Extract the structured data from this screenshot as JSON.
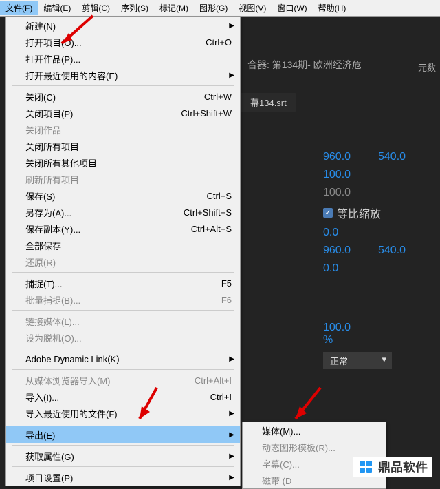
{
  "menubar": [
    "文件(F)",
    "编辑(E)",
    "剪辑(C)",
    "序列(S)",
    "标记(M)",
    "图形(G)",
    "视图(V)",
    "窗口(W)",
    "帮助(H)"
  ],
  "menu": [
    {
      "t": "item",
      "label": "新建(N)",
      "arrow": true
    },
    {
      "t": "item",
      "label": "打开项目(O)...",
      "sc": "Ctrl+O"
    },
    {
      "t": "item",
      "label": "打开作品(P)..."
    },
    {
      "t": "item",
      "label": "打开最近使用的内容(E)",
      "arrow": true
    },
    {
      "t": "sep"
    },
    {
      "t": "item",
      "label": "关闭(C)",
      "sc": "Ctrl+W"
    },
    {
      "t": "item",
      "label": "关闭项目(P)",
      "sc": "Ctrl+Shift+W"
    },
    {
      "t": "item",
      "label": "关闭作品",
      "disabled": true
    },
    {
      "t": "item",
      "label": "关闭所有项目"
    },
    {
      "t": "item",
      "label": "关闭所有其他项目"
    },
    {
      "t": "item",
      "label": "刷新所有项目",
      "disabled": true
    },
    {
      "t": "item",
      "label": "保存(S)",
      "sc": "Ctrl+S"
    },
    {
      "t": "item",
      "label": "另存为(A)...",
      "sc": "Ctrl+Shift+S"
    },
    {
      "t": "item",
      "label": "保存副本(Y)...",
      "sc": "Ctrl+Alt+S"
    },
    {
      "t": "item",
      "label": "全部保存"
    },
    {
      "t": "item",
      "label": "还原(R)",
      "disabled": true
    },
    {
      "t": "sep"
    },
    {
      "t": "item",
      "label": "捕捉(T)...",
      "sc": "F5"
    },
    {
      "t": "item",
      "label": "批量捕捉(B)...",
      "sc": "F6",
      "disabled": true
    },
    {
      "t": "sep"
    },
    {
      "t": "item",
      "label": "链接媒体(L)...",
      "disabled": true
    },
    {
      "t": "item",
      "label": "设为脱机(O)...",
      "disabled": true
    },
    {
      "t": "sep"
    },
    {
      "t": "item",
      "label": "Adobe Dynamic Link(K)",
      "arrow": true
    },
    {
      "t": "sep"
    },
    {
      "t": "item",
      "label": "从媒体浏览器导入(M)",
      "sc": "Ctrl+Alt+I",
      "disabled": true
    },
    {
      "t": "item",
      "label": "导入(I)...",
      "sc": "Ctrl+I"
    },
    {
      "t": "item",
      "label": "导入最近使用的文件(F)",
      "arrow": true
    },
    {
      "t": "sep"
    },
    {
      "t": "item",
      "label": "导出(E)",
      "arrow": true,
      "highlight": true
    },
    {
      "t": "sep"
    },
    {
      "t": "item",
      "label": "获取属性(G)",
      "arrow": true
    },
    {
      "t": "sep"
    },
    {
      "t": "item",
      "label": "项目设置(P)",
      "arrow": true
    }
  ],
  "submenu": [
    {
      "label": "媒体(M)..."
    },
    {
      "label": "动态图形模板(R)...",
      "disabled": true
    },
    {
      "label": "字幕(C)...",
      "disabled": true
    },
    {
      "label": "磁带 (D",
      "disabled": true
    }
  ],
  "panel": {
    "header": "合器: 第134期- 欧洲经济危",
    "yuanshu": "元数",
    "srt": "幕134.srt",
    "rows": {
      "r1a": "960.0",
      "r1b": "540.0",
      "r2": "100.0",
      "r3": "100.0",
      "chk": "等比缩放",
      "r4": "0.0",
      "r5a": "960.0",
      "r5b": "540.0",
      "r6": "0.0",
      "pct": "100.0 %",
      "blend": "正常"
    }
  },
  "logo": "鼎品软件"
}
